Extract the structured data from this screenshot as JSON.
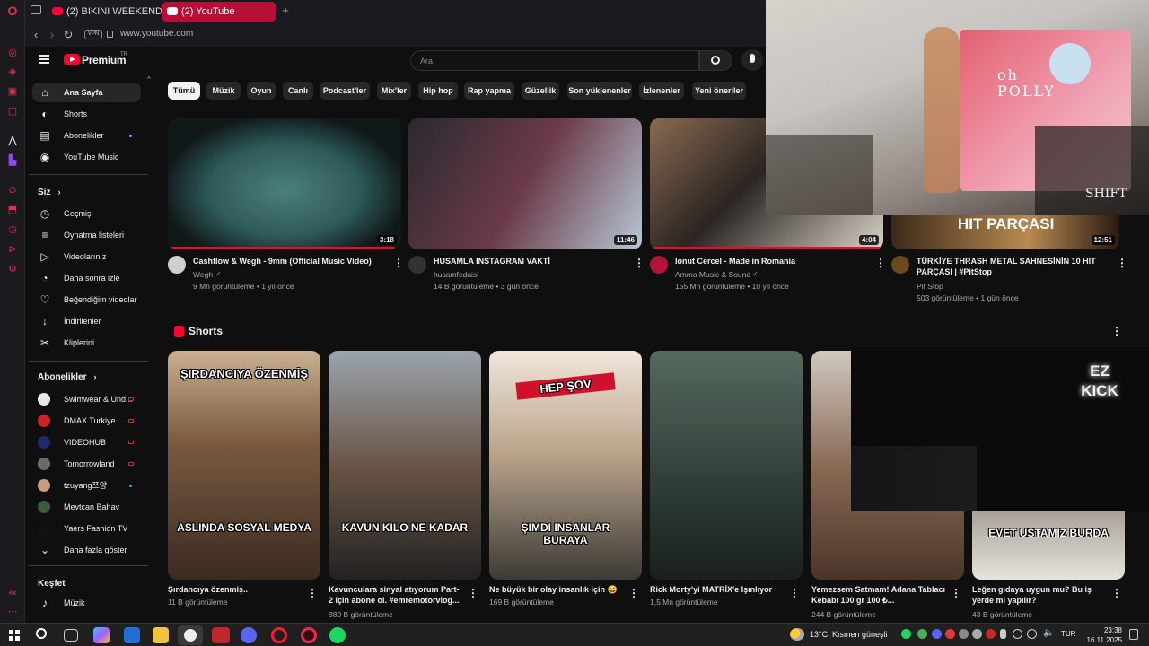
{
  "browser": {
    "tabs": [
      {
        "label": "(2) BIKINI WEEKEND wate"
      },
      {
        "label": "(2) YouTube"
      }
    ],
    "new_tab": "+",
    "vpn_badge": "VPN",
    "url": "www.youtube.com"
  },
  "header": {
    "logo_text": "Premium",
    "logo_sup": "TR",
    "search_placeholder": "Ara"
  },
  "chips": [
    "Tümü",
    "Müzik",
    "Oyun",
    "Canlı",
    "Podcast'ler",
    "Mix'ler",
    "Hip hop",
    "Rap yapma",
    "Güzellik",
    "Son yüklenenler",
    "İzlenenler",
    "Yeni öneriler"
  ],
  "sidebar": {
    "main": [
      {
        "label": "Ana Sayfa",
        "icon": "home-icon"
      },
      {
        "label": "Shorts",
        "icon": "shorts-icon"
      },
      {
        "label": "Abonelikler",
        "icon": "subscriptions-icon"
      },
      {
        "label": "YouTube Music",
        "icon": "music-icon"
      }
    ],
    "you_header": "Siz",
    "you": [
      {
        "label": "Geçmiş",
        "icon": "history-icon"
      },
      {
        "label": "Oynatma listeleri",
        "icon": "playlist-icon"
      },
      {
        "label": "Videolarınız",
        "icon": "your-videos-icon"
      },
      {
        "label": "Daha sonra izle",
        "icon": "watch-later-icon"
      },
      {
        "label": "Beğendiğim videolar",
        "icon": "like-icon"
      },
      {
        "label": "İndirilenler",
        "icon": "download-icon"
      },
      {
        "label": "Kliplerini",
        "icon": "clips-icon"
      }
    ],
    "subs_header": "Abonelikler",
    "subs": [
      {
        "label": "Swimwear & Und...",
        "color": "#e8e8e8"
      },
      {
        "label": "DMAX Turkiye",
        "color": "#d11f26"
      },
      {
        "label": "VIDEOHUB",
        "color": "#1d2a6b"
      },
      {
        "label": "Tomorrowland",
        "color": "#6b6b6b"
      },
      {
        "label": "tzuyang쯔양",
        "color": "#c99c7b"
      },
      {
        "label": "Mevtcan Bahav",
        "color": "#3b5b3e"
      },
      {
        "label": "Yaers Fashion TV",
        "color": "#111111"
      }
    ],
    "show_more": "Daha fazla göster",
    "explore_header": "Keşfet",
    "explore": [
      {
        "label": "Müzik",
        "icon": "music-note-icon"
      }
    ]
  },
  "videos": [
    {
      "title": "Cashflow & Wegh - 9mm (Official Music Video)",
      "channel": "Wegh",
      "meta": "9 Mn görüntüleme • 1 yıl önce",
      "duration": "3:18",
      "progress": 0.97
    },
    {
      "title": "HUSAMLA INSTAGRAM VAKTİ",
      "channel": "husamfedaisi",
      "meta": "14 B görüntüleme • 3 gün önce",
      "duration": "11:46",
      "progress": 0
    },
    {
      "title": "Ionut Cercel - Made in Romania",
      "channel": "Amma Music & Sound",
      "meta": "155 Mn görüntüleme • 10 yıl önce",
      "duration": "4:04",
      "progress": 1.0
    },
    {
      "title": "TÜRKİYE THRASH METAL SAHNESİNİN 10 HIT PARÇASI | #PitStop",
      "channel": "Pit Stop",
      "meta": "503 görüntüleme • 1 gün önce",
      "duration": "12:51",
      "progress": 0
    }
  ],
  "video4_overlay": "HIT PARÇASI",
  "shorts_header": "Shorts",
  "shorts": [
    {
      "title": "Şırdancıya özenmiş..",
      "views": "11 B görüntüleme",
      "top_text": "ŞIRDANCIYA ÖZENMİŞ",
      "bottom_text": "ASLINDA SOSYAL MEDYA"
    },
    {
      "title": "Kavunculara sinyal atıyorum Part-2  için abone ol. #emremotorvlog...",
      "views": "889 B görüntüleme",
      "top_text": "",
      "bottom_text": "KAVUN KILO NE KADAR"
    },
    {
      "title": "Ne büyük bir olay insanlık için 😆",
      "views": "169 B görüntüleme",
      "top_text": "HEP ŞOV",
      "bottom_text": "ŞIMDI INSANLAR BURAYA"
    },
    {
      "title": "Rick Morty'yi MATRİX'e Işınlıyor",
      "views": "1,5 Mn görüntüleme",
      "top_text": "",
      "bottom_text": ""
    },
    {
      "title": "Yemezsem Satmam! Adana Tablacı Kebabı 100 gr 100 ₺...",
      "views": "244 B görüntüleme",
      "top_text": "",
      "bottom_text": ""
    },
    {
      "title": "Leğen gıdaya uygun mu? Bu iş yerde mi yapılır?",
      "views": "43 B görüntüleme",
      "top_text": "",
      "bottom_text": "EVET USTAMIZ BURDA"
    }
  ],
  "pip_top": {
    "brand": "oh POLLY",
    "watermark": "SHIFT"
  },
  "pip_bottom": {
    "sign": "EZ KICK"
  },
  "taskbar": {
    "weather": "13°C",
    "weather_text": "Kısmen güneşli",
    "lang": "TUR",
    "time": "23:38",
    "date": "16.11.2025"
  },
  "colors": {
    "accent": "#ff0033",
    "opera": "#e0304e",
    "bg": "#0f0f0f"
  }
}
